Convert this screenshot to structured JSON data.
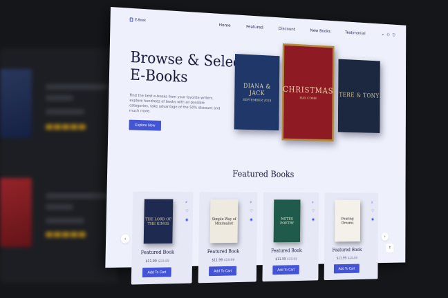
{
  "site": {
    "logo_text": "E-Book",
    "nav": [
      "Home",
      "Featured",
      "Discount",
      "New Books",
      "Testimonial"
    ]
  },
  "hero": {
    "title": "Browse & Select E-Books",
    "description": "Find the best e-books from your favorite writers, explore hundreds of books with all possible categories, take advantage of the 50% discount and much more.",
    "button": "Explore Now",
    "covers": [
      {
        "line1": "DIANA & JACK",
        "line2": "SEPTEMBER 2024"
      },
      {
        "line1": "CHRISTMAS",
        "line2": "HAS COME"
      },
      {
        "line1": "TERE & TONY",
        "line2": ""
      }
    ]
  },
  "featured": {
    "title": "Featured Books",
    "cards": [
      {
        "cover": "THE LORD OF THE KINGS",
        "name": "Featured Book",
        "price": "$11.99",
        "old_price": "$19.99",
        "button": "Add To Cart",
        "color": "#1e2a4f",
        "text_color": "#e8d8a0"
      },
      {
        "cover": "Simple Way of Minimalist",
        "name": "Featured Book",
        "price": "$11.99",
        "old_price": "$19.99",
        "button": "Add To Cart",
        "color": "#efeae0",
        "text_color": "#2a2a2a"
      },
      {
        "cover": "NOTES POETRY",
        "name": "Featured Book",
        "price": "$11.99",
        "old_price": "$19.99",
        "button": "Add To Cart",
        "color": "#1f5a4a",
        "text_color": "#f1e6cf"
      },
      {
        "cover": "Pouring Dreams",
        "name": "Featured Book",
        "price": "$11.99",
        "old_price": "$19.99",
        "button": "Add To Cart",
        "color": "#f3f1ea",
        "text_color": "#1a1a1a"
      }
    ]
  },
  "colors": {
    "accent": "#4354d4",
    "page_bg": "#eef0fb",
    "ink": "#15183a"
  },
  "icons": [
    "search-icon",
    "user-icon",
    "cart-icon",
    "chevron-left-icon",
    "chevron-right-icon",
    "arrow-up-icon",
    "heart-icon",
    "eye-icon"
  ]
}
